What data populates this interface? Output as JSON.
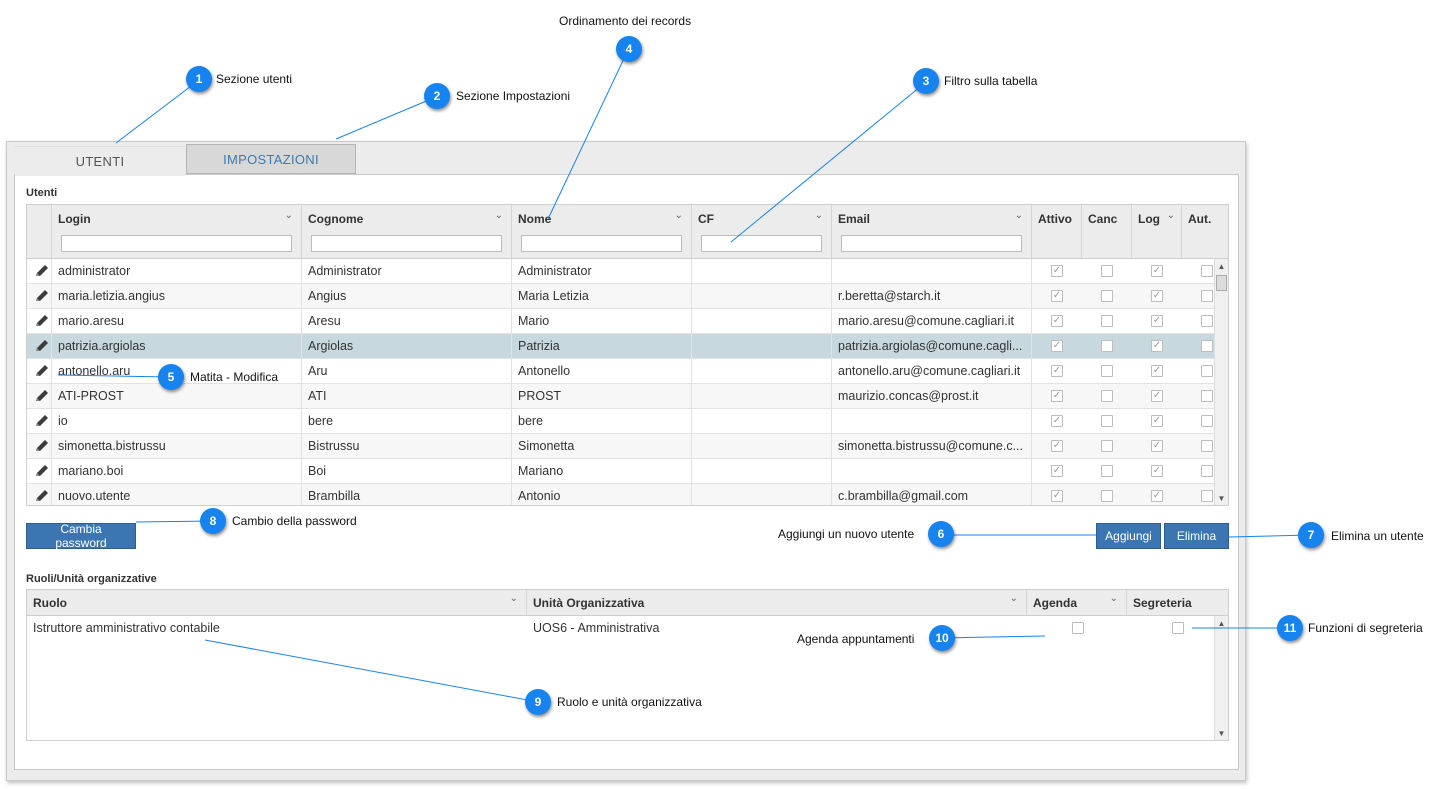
{
  "tabs": [
    {
      "label": "UTENTI",
      "active": true
    },
    {
      "label": "IMPOSTAZIONI",
      "active": false
    }
  ],
  "users_section": {
    "title": "Utenti",
    "columns": [
      "Login",
      "Cognome",
      "Nome",
      "CF",
      "Email",
      "Attivo",
      "Canc",
      "Log",
      "Aut."
    ],
    "rows": [
      {
        "login": "administrator",
        "cognome": "Administrator",
        "nome": "Administrator",
        "cf": "",
        "email": "",
        "attivo": true,
        "canc": false,
        "log": true,
        "aut": false
      },
      {
        "login": "maria.letizia.angius",
        "cognome": "Angius",
        "nome": "Maria Letizia",
        "cf": "",
        "email": "r.beretta@starch.it",
        "attivo": true,
        "canc": false,
        "log": true,
        "aut": false
      },
      {
        "login": "mario.aresu",
        "cognome": "Aresu",
        "nome": "Mario",
        "cf": "",
        "email": "mario.aresu@comune.cagliari.it",
        "attivo": true,
        "canc": false,
        "log": true,
        "aut": false
      },
      {
        "login": "patrizia.argiolas",
        "cognome": "Argiolas",
        "nome": "Patrizia",
        "cf": "",
        "email": "patrizia.argiolas@comune.cagli...",
        "attivo": true,
        "canc": false,
        "log": true,
        "aut": false
      },
      {
        "login": "antonello.aru",
        "cognome": "Aru",
        "nome": "Antonello",
        "cf": "",
        "email": "antonello.aru@comune.cagliari.it",
        "attivo": true,
        "canc": false,
        "log": true,
        "aut": false
      },
      {
        "login": "ATI-PROST",
        "cognome": "ATI",
        "nome": "PROST",
        "cf": "",
        "email": "maurizio.concas@prost.it",
        "attivo": true,
        "canc": false,
        "log": true,
        "aut": false
      },
      {
        "login": "io",
        "cognome": "bere",
        "nome": "bere",
        "cf": "",
        "email": "",
        "attivo": true,
        "canc": false,
        "log": true,
        "aut": false
      },
      {
        "login": "simonetta.bistrussu",
        "cognome": "Bistrussu",
        "nome": "Simonetta",
        "cf": "",
        "email": "simonetta.bistrussu@comune.c...",
        "attivo": true,
        "canc": false,
        "log": true,
        "aut": false
      },
      {
        "login": "mariano.boi",
        "cognome": "Boi",
        "nome": "Mariano",
        "cf": "",
        "email": "",
        "attivo": true,
        "canc": false,
        "log": true,
        "aut": false
      },
      {
        "login": "nuovo.utente",
        "cognome": "Brambilla",
        "nome": "Antonio",
        "cf": "",
        "email": "c.brambilla@gmail.com",
        "attivo": true,
        "canc": false,
        "log": true,
        "aut": false
      }
    ],
    "selected_row": 3
  },
  "buttons": {
    "change_password": "Cambia password",
    "add": "Aggiungi",
    "delete": "Elimina"
  },
  "roles_section": {
    "title": "Ruoli/Unità organizzative",
    "columns": [
      "Ruolo",
      "Unità Organizzativa",
      "Agenda",
      "Segreteria"
    ],
    "rows": [
      {
        "ruolo": "Istruttore amministrativo contabile",
        "unita": "UOS6 - Amministrativa",
        "agenda": false,
        "segreteria": false
      }
    ]
  },
  "callouts": [
    {
      "n": "1",
      "label": "Sezione utenti"
    },
    {
      "n": "2",
      "label": "Sezione Impostazioni"
    },
    {
      "n": "3",
      "label": "Filtro sulla tabella"
    },
    {
      "n": "4",
      "label": "Ordinamento dei records"
    },
    {
      "n": "5",
      "label": "Matita - Modifica"
    },
    {
      "n": "6",
      "label": "Aggiungi un nuovo utente"
    },
    {
      "n": "7",
      "label": "Elimina un utente"
    },
    {
      "n": "8",
      "label": "Cambio della password"
    },
    {
      "n": "9",
      "label": "Ruolo e unità organizzativa"
    },
    {
      "n": "10",
      "label": "Agenda appuntamenti"
    },
    {
      "n": "11",
      "label": "Funzioni di segreteria"
    }
  ],
  "icons": {
    "edit": "pencil-icon",
    "sort": "chevron-down-icon",
    "check": "checkmark-icon"
  },
  "colors": {
    "accent": "#3c76b2",
    "callout": "#1683ee",
    "selected_row": "#c8d8df",
    "tab_link": "#3a7ab5"
  }
}
